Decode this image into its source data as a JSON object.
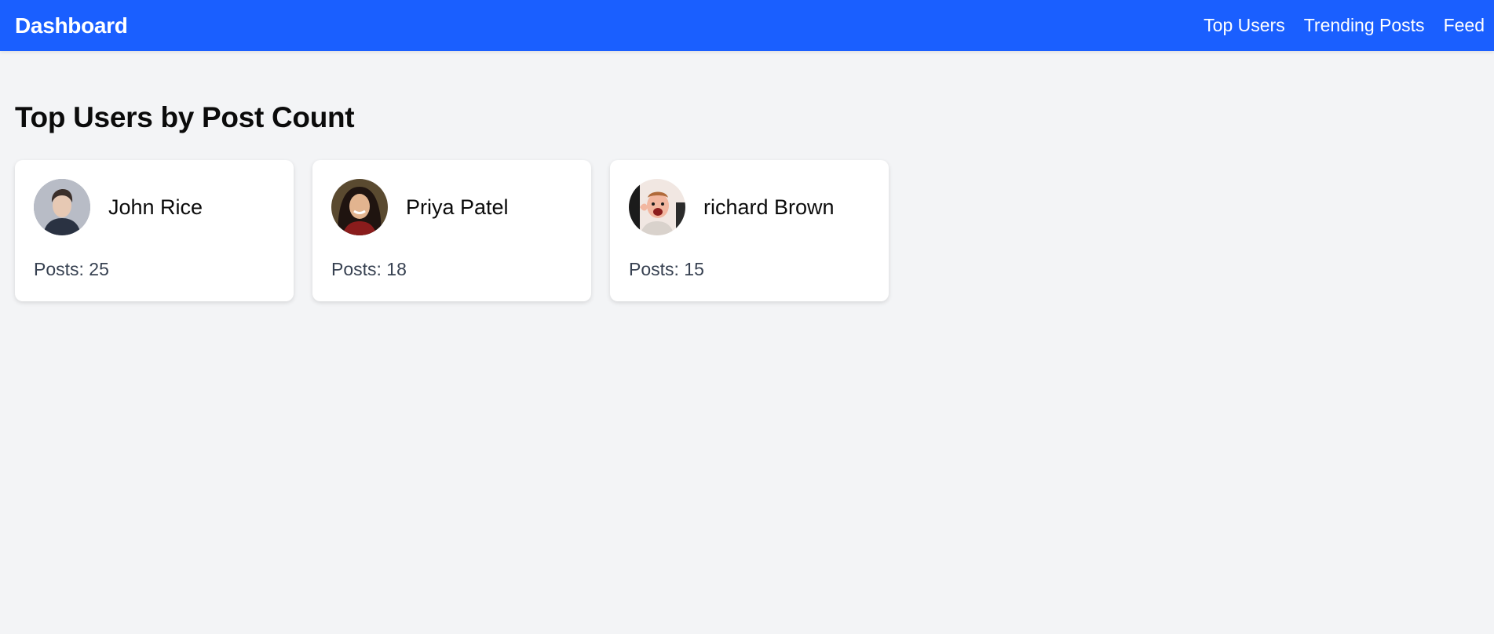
{
  "navbar": {
    "brand": "Dashboard",
    "links": [
      "Top Users",
      "Trending Posts",
      "Feed"
    ],
    "color": "#1a5fff"
  },
  "main": {
    "title": "Top Users by Post Count",
    "users": [
      {
        "name": "John Rice",
        "posts_label": "Posts: 25",
        "posts": 25,
        "avatar": "user-photo-avatar"
      },
      {
        "name": "Priya Patel",
        "posts_label": "Posts: 18",
        "posts": 18,
        "avatar": "user-photo-avatar"
      },
      {
        "name": "richard Brown",
        "posts_label": "Posts: 15",
        "posts": 15,
        "avatar": "user-photo-avatar"
      }
    ]
  }
}
